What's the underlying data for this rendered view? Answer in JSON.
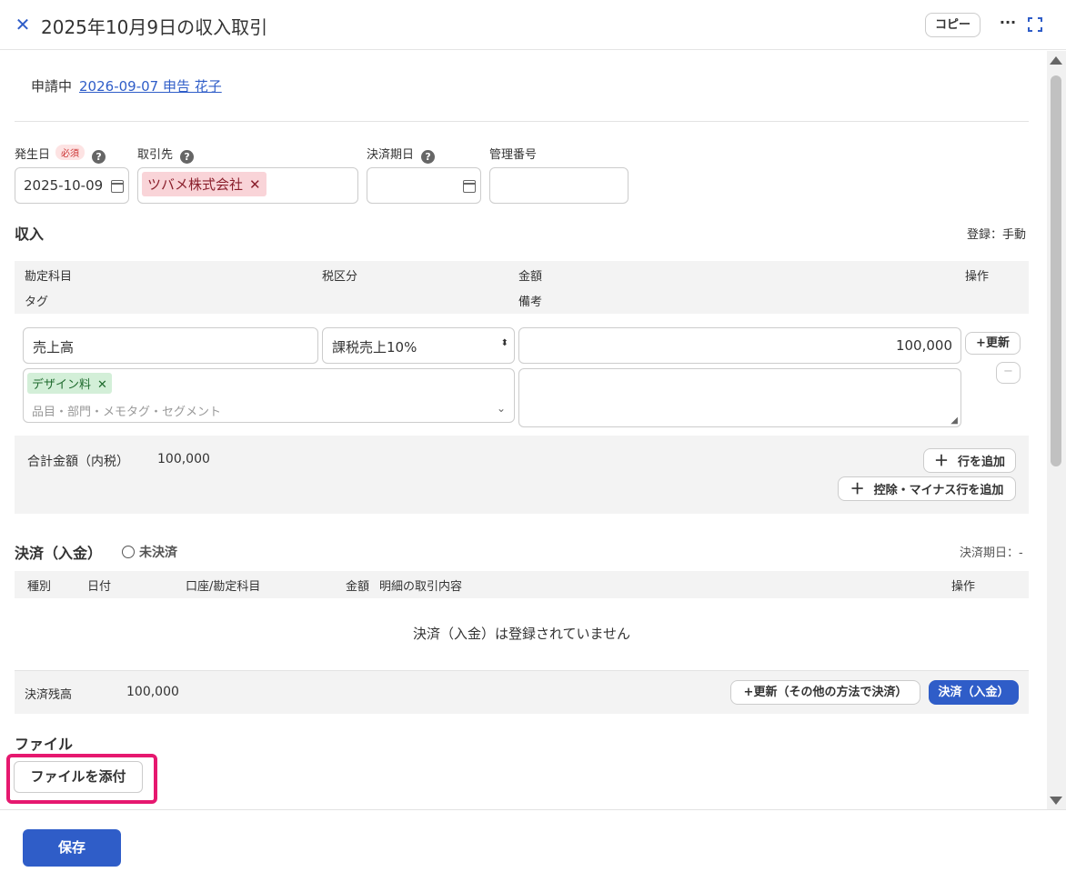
{
  "header": {
    "close_icon": "close-icon",
    "title": "2025年10月9日の収入取引",
    "copy_label": "コピー",
    "more_icon": "more-icon",
    "expand_icon": "expand-icon"
  },
  "status": {
    "label": "申請中",
    "link_text": "2026-09-07 申告 花子"
  },
  "fields": {
    "date_label": "発生日",
    "required_badge": "必須",
    "date_value": "2025-10-09",
    "partner_label": "取引先",
    "partner_tag": "ツバメ株式会社",
    "settle_date_label": "決済期日",
    "settle_date_value": "",
    "mgmt_no_label": "管理番号",
    "mgmt_no_value": ""
  },
  "income": {
    "section_title": "収入",
    "register_mode": "登録：手動",
    "columns": {
      "account": "勘定科目",
      "tax": "税区分",
      "amount": "金額",
      "ops": "操作",
      "tag": "タグ",
      "remarks": "備考"
    },
    "row": {
      "account": "売上高",
      "tax": "課税売上10%",
      "amount": "100,000",
      "update_btn": "+更新",
      "tag": "デザイン料",
      "tag_placeholder": "品目・部門・メモタグ・セグメント",
      "remarks": ""
    },
    "total_label": "合計金額（内税）",
    "total_value": "100,000",
    "add_row": "行を追加",
    "add_minus_row": "控除・マイナス行を追加"
  },
  "settlement": {
    "section_title": "決済（入金）",
    "status": "未決済",
    "due": "決済期日：-",
    "columns": {
      "type": "種別",
      "date": "日付",
      "account": "口座/勘定科目",
      "amount": "金額",
      "detail": "明細の取引内容",
      "ops": "操作"
    },
    "empty_message": "決済（入金）は登録されていません",
    "balance_label": "決済残高",
    "balance_value": "100,000",
    "update_other": "+更新（その他の方法で決済）",
    "settle_btn": "決済（入金）"
  },
  "files": {
    "section_title": "ファイル",
    "attach_btn": "ファイルを添付"
  },
  "footer": {
    "save": "保存"
  },
  "colors": {
    "primary": "#2f5dc8",
    "highlight": "#e6186f",
    "tag_pink": "#f9d4d8",
    "tag_green": "#d3efd8"
  }
}
